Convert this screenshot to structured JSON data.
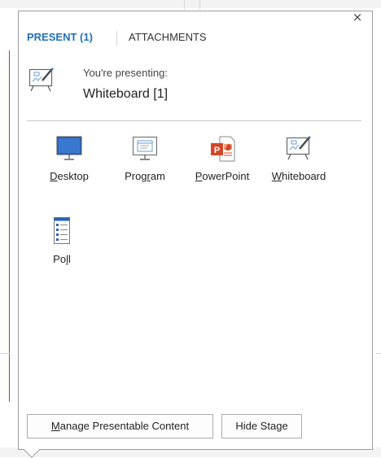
{
  "tabs": [
    {
      "label": "PRESENT (1)",
      "active": true
    },
    {
      "label": "ATTACHMENTS",
      "active": false
    }
  ],
  "close_glyph": "×",
  "status": {
    "line1": "You're presenting:",
    "line2": "Whiteboard [1]",
    "icon": "whiteboard-icon"
  },
  "options": [
    {
      "id": "desktop",
      "label": "Desktop",
      "underline_char_index": 0,
      "icon": "desktop-monitor-icon"
    },
    {
      "id": "program",
      "label": "Program",
      "underline_char_index": 4,
      "icon": "program-window-icon"
    },
    {
      "id": "powerpoint",
      "label": "PowerPoint",
      "underline_char_index": 0,
      "icon": "powerpoint-icon"
    },
    {
      "id": "whiteboard",
      "label": "Whiteboard",
      "underline_char_index": 0,
      "icon": "whiteboard-icon"
    },
    {
      "id": "poll",
      "label": "Poll",
      "underline_char_index": 2,
      "icon": "poll-icon"
    }
  ],
  "buttons": [
    {
      "id": "manage",
      "label": "Manage Presentable Content",
      "underline_char_index": 0
    },
    {
      "id": "hide",
      "label": "Hide Stage",
      "underline_char_index": 8
    }
  ],
  "colors": {
    "accent": "#1f6fb8",
    "powerpoint": "#d24726",
    "border": "#9c9c9c"
  }
}
